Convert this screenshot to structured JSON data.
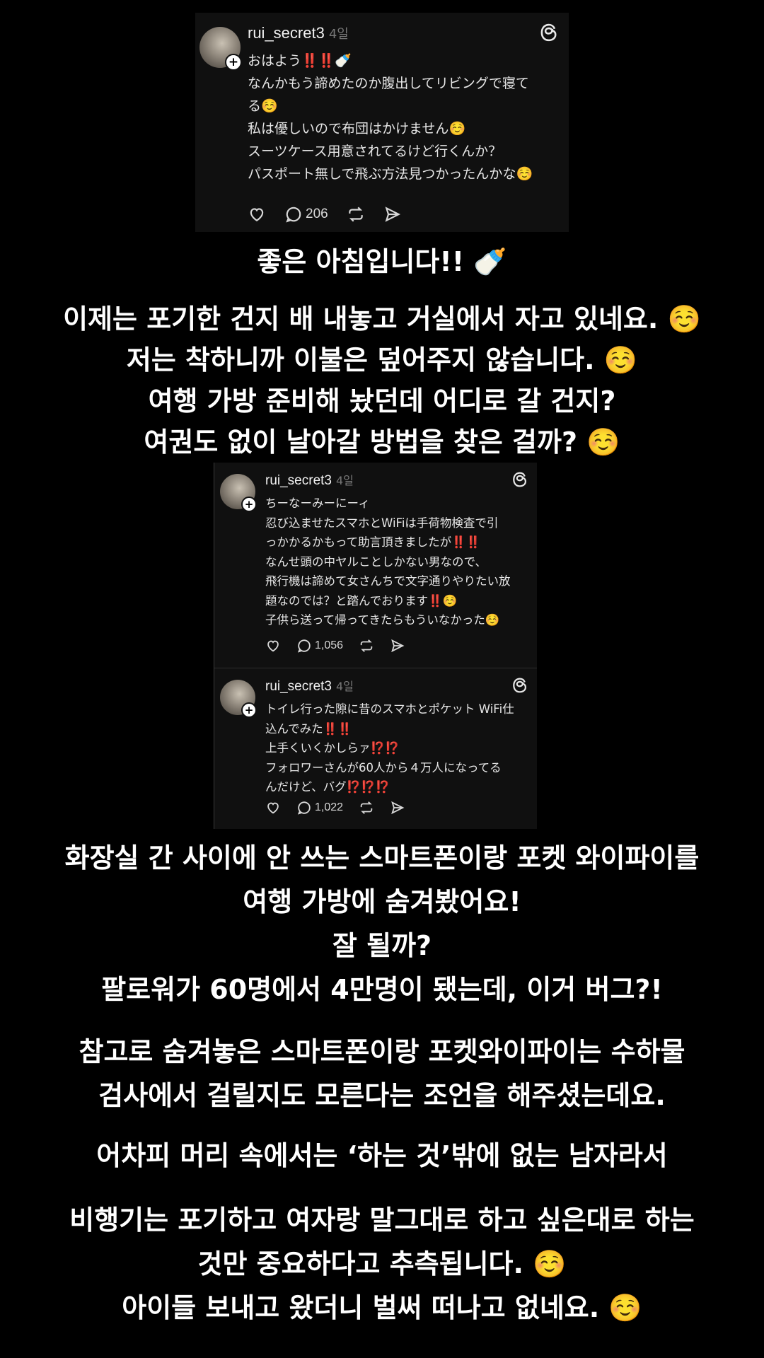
{
  "posts": [
    {
      "username": "rui_secret3",
      "time_ago": "4일",
      "lines": [
        {
          "text": "おはよう",
          "marks": "‼️‼️",
          "tail": "🍼"
        },
        {
          "text": "なんかもう諦めたのか腹出してリビングで寝て",
          "marks": "",
          "tail": ""
        },
        {
          "text": "る",
          "marks": "",
          "tail": "☺️"
        },
        {
          "text": "私は優しいので布団はかけません",
          "marks": "",
          "tail": "☺️"
        },
        {
          "text": "スーツケース用意されてるけど行くんか？",
          "marks": "",
          "tail": ""
        },
        {
          "text": "パスポート無しで飛ぶ方法見つかったんかな",
          "marks": "",
          "tail": "☺️"
        }
      ],
      "reply_count": "206"
    },
    {
      "username": "rui_secret3",
      "time_ago": "4일",
      "lines": [
        {
          "text": "ちーなーみーにーィ",
          "marks": "",
          "tail": ""
        },
        {
          "text": "忍び込ませたスマホとWiFiは手荷物検査で引",
          "marks": "",
          "tail": ""
        },
        {
          "text": "っかかるかもって助言頂きましたが",
          "marks": "‼️‼️",
          "tail": ""
        },
        {
          "text": "なんせ頭の中ヤルことしかない男なので、",
          "marks": "",
          "tail": ""
        },
        {
          "text": "飛行機は諦めて女さんちで文字通りやりたい放",
          "marks": "",
          "tail": ""
        },
        {
          "text": "題なのでは？と踏んでおります",
          "marks": "‼️",
          "tail": "☺️"
        },
        {
          "text": "子供ら送って帰ってきたらもういなかった",
          "marks": "",
          "tail": "☺️"
        }
      ],
      "reply_count": "1,056"
    },
    {
      "username": "rui_secret3",
      "time_ago": "4일",
      "lines": [
        {
          "text": "トイレ行った隙に昔のスマホとポケット WiFi仕",
          "marks": "",
          "tail": ""
        },
        {
          "text": "込んでみた",
          "marks": "‼️‼️",
          "tail": ""
        },
        {
          "text": "上手くいくかしらァ",
          "marks": "⁉️⁉️",
          "tail": ""
        },
        {
          "text": "フォロワーさんが60人から４万人になってる",
          "marks": "",
          "tail": ""
        },
        {
          "text": "んだけど、バグ",
          "marks": "⁉️⁉️⁉️",
          "tail": ""
        }
      ],
      "reply_count": "1,022"
    }
  ],
  "captions": {
    "block1": [
      "좋은 아침입니다!! 🍼"
    ],
    "block2": [
      "이제는 포기한 건지 배 내놓고 거실에서 자고 있네요. ☺️",
      "저는 착하니까 이불은 덮어주지 않습니다. ☺️",
      "여행 가방 준비해 놨던데 어디로 갈 건지?",
      "여권도 없이 날아갈 방법을 찾은 걸까? ☺️"
    ],
    "block3": [
      "화장실 간 사이에 안 쓰는 스마트폰이랑 포켓 와이파이를",
      "여행 가방에 숨겨봤어요!",
      "잘 될까?",
      "팔로워가 60명에서 4만명이 됐는데, 이거 버그?!"
    ],
    "block4": [
      "참고로 숨겨놓은 스마트폰이랑 포켓와이파이는 수하물",
      "검사에서 걸릴지도 모른다는 조언을 해주셨는데요."
    ],
    "block5": [
      "어차피 머리 속에서는 ‘하는 것’밖에 없는 남자라서"
    ],
    "block6": [
      "비행기는 포기하고 여자랑 말그대로 하고 싶은대로 하는",
      "것만 중요하다고 추측됩니다. ☺️",
      "아이들 보내고 왔더니 벌써 떠나고 없네요. ☺️"
    ]
  },
  "icons": {
    "threads": "threads-logo-icon",
    "like": "heart-icon",
    "reply": "speech-bubble-icon",
    "repost": "repost-icon",
    "share": "send-icon"
  },
  "colors": {
    "background": "#000000",
    "card": "#101010",
    "exclaim_red": "#e3222b",
    "emoji_yellow": "#f2b33d"
  }
}
